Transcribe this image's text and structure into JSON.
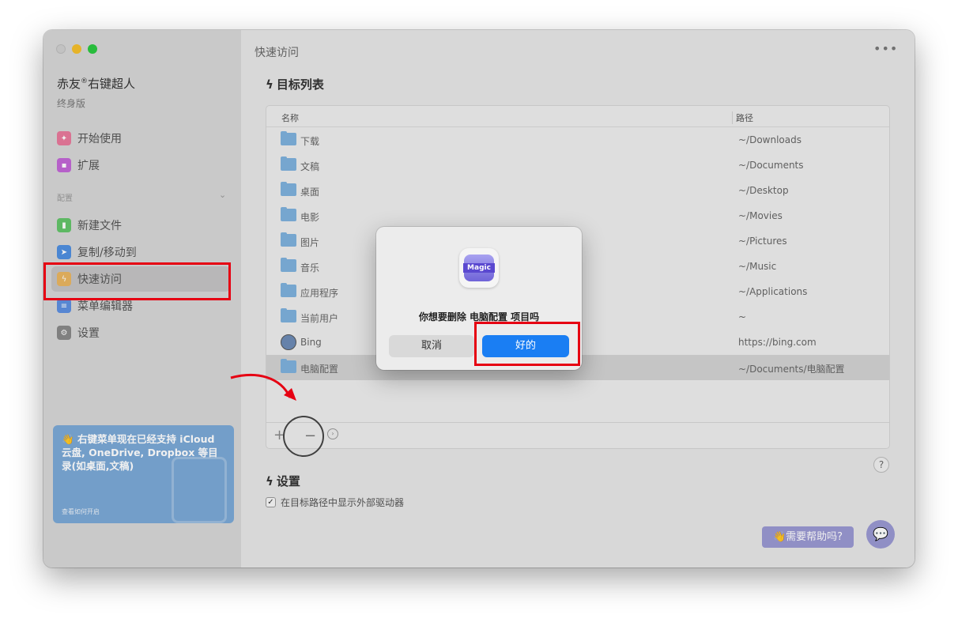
{
  "sidebar": {
    "app_name": "赤友",
    "app_name_sup": "®",
    "app_name_suffix": "右键超人",
    "edition": "终身版",
    "items_top": [
      {
        "label": "开始使用",
        "icon": "lightbulb-icon"
      },
      {
        "label": "扩展",
        "icon": "puzzle-icon"
      }
    ],
    "section_label": "配置",
    "items_config": [
      {
        "label": "新建文件",
        "icon": "new-file-icon"
      },
      {
        "label": "复制/移动到",
        "icon": "send-icon"
      },
      {
        "label": "快速访问",
        "icon": "bolt-icon",
        "active": true
      },
      {
        "label": "菜单编辑器",
        "icon": "list-icon"
      },
      {
        "label": "设置",
        "icon": "gear-icon"
      }
    ],
    "promo": {
      "emoji": "👋",
      "text": "右键菜单现在已经支持 iCloud 云盘, OneDrive, Dropbox 等目录(如桌面,文稿)",
      "link": "查看如何开启"
    }
  },
  "main": {
    "title": "快速访问",
    "more": "•••",
    "targets_heading": "目标列表",
    "columns": {
      "name": "名称",
      "path": "路径"
    },
    "rows": [
      {
        "name": "下载",
        "path": "~/Downloads"
      },
      {
        "name": "文稿",
        "path": "~/Documents"
      },
      {
        "name": "桌面",
        "path": "~/Desktop"
      },
      {
        "name": "电影",
        "path": "~/Movies"
      },
      {
        "name": "图片",
        "path": "~/Pictures"
      },
      {
        "name": "音乐",
        "path": "~/Music"
      },
      {
        "name": "应用程序",
        "path": "~/Applications"
      },
      {
        "name": "当前用户",
        "path": "~"
      },
      {
        "name": "Bing",
        "path": "https://bing.com",
        "icon": "globe-icon"
      },
      {
        "name": "电脑配置",
        "path": "~/Documents/电脑配置",
        "selected": true
      }
    ],
    "toolbar": {
      "add": "+",
      "remove": "−",
      "more": "›"
    },
    "settings_heading": "设置",
    "show_external_drives": {
      "checked": true,
      "mark": "✓",
      "label": "在目标路径中显示外部驱动器"
    },
    "help_question": "?",
    "help_button": "👋需要帮助吗?"
  },
  "dialog": {
    "icon_text": "Magic",
    "message": "你想要删除 电脑配置 项目吗",
    "cancel": "取消",
    "ok": "好的"
  },
  "colors": {
    "annotation_red": "#e60012",
    "ok_blue": "#1a7ef3",
    "help_purple": "#9a98d2"
  }
}
